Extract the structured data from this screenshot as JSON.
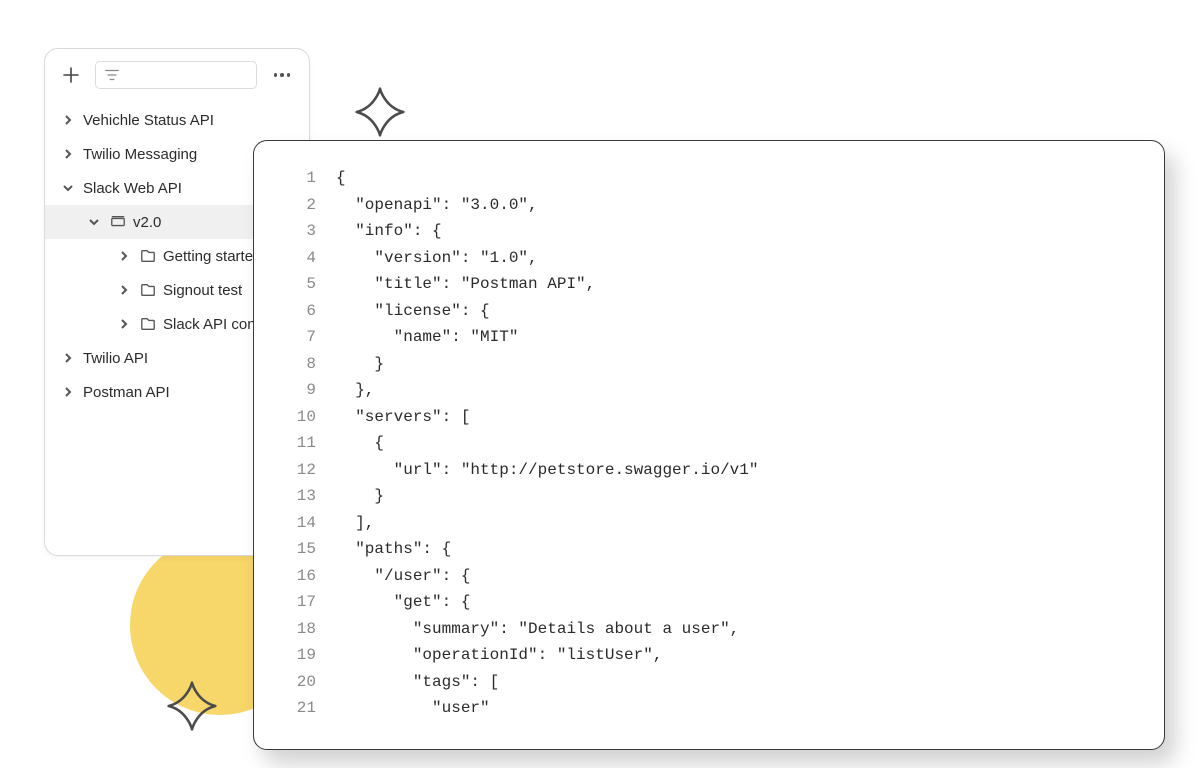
{
  "sidebar": {
    "items": [
      {
        "label": "Vehichle Status API",
        "expanded": false,
        "level": 0,
        "icon": "none"
      },
      {
        "label": "Twilio Messaging",
        "expanded": false,
        "level": 0,
        "icon": "none"
      },
      {
        "label": "Slack Web API",
        "expanded": true,
        "level": 0,
        "icon": "none"
      },
      {
        "label": "v2.0",
        "expanded": true,
        "level": 1,
        "icon": "collection",
        "selected": true
      },
      {
        "label": "Getting started",
        "expanded": false,
        "level": 2,
        "icon": "folder"
      },
      {
        "label": "Signout test",
        "expanded": false,
        "level": 2,
        "icon": "folder"
      },
      {
        "label": "Slack API contr",
        "expanded": false,
        "level": 2,
        "icon": "folder"
      },
      {
        "label": "Twilio API",
        "expanded": false,
        "level": 0,
        "icon": "none"
      },
      {
        "label": "Postman API",
        "expanded": false,
        "level": 0,
        "icon": "none"
      }
    ]
  },
  "code": {
    "lines": [
      {
        "n": "1",
        "t": "{"
      },
      {
        "n": "2",
        "t": "  \"openapi\": \"3.0.0\","
      },
      {
        "n": "3",
        "t": "  \"info\": {"
      },
      {
        "n": "4",
        "t": "    \"version\": \"1.0\","
      },
      {
        "n": "5",
        "t": "    \"title\": \"Postman API\","
      },
      {
        "n": "6",
        "t": "    \"license\": {"
      },
      {
        "n": "7",
        "t": "      \"name\": \"MIT\""
      },
      {
        "n": "8",
        "t": "    }"
      },
      {
        "n": "9",
        "t": "  },"
      },
      {
        "n": "10",
        "t": "  \"servers\": ["
      },
      {
        "n": "11",
        "t": "    {"
      },
      {
        "n": "12",
        "t": "      \"url\": \"http://petstore.swagger.io/v1\""
      },
      {
        "n": "13",
        "t": "    }"
      },
      {
        "n": "14",
        "t": "  ],"
      },
      {
        "n": "15",
        "t": "  \"paths\": {"
      },
      {
        "n": "16",
        "t": "    \"/user\": {"
      },
      {
        "n": "17",
        "t": "      \"get\": {"
      },
      {
        "n": "18",
        "t": "        \"summary\": \"Details about a user\","
      },
      {
        "n": "19",
        "t": "        \"operationId\": \"listUser\","
      },
      {
        "n": "20",
        "t": "        \"tags\": ["
      },
      {
        "n": "21",
        "t": "          \"user\""
      }
    ]
  }
}
